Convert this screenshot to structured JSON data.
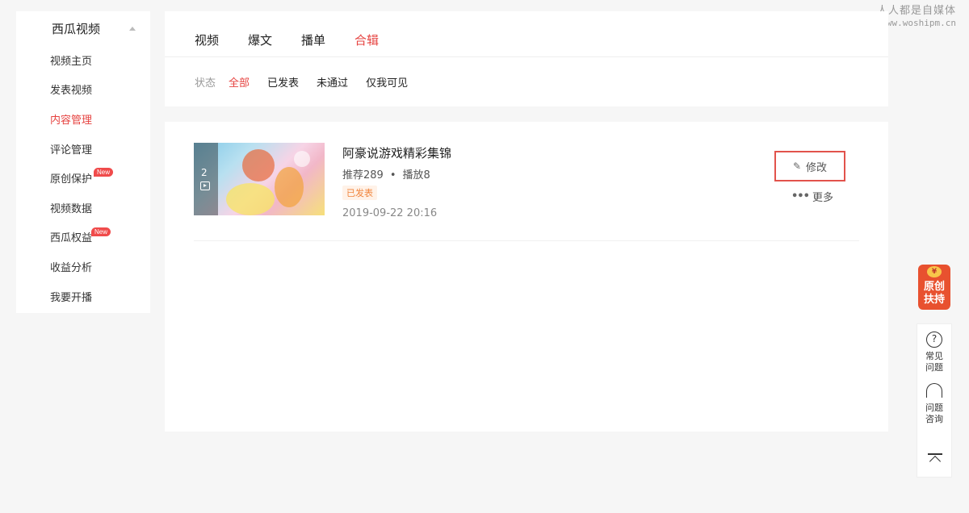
{
  "watermark": {
    "cn": "人人都是自媒体",
    "en": "www.woshipm.cn"
  },
  "sidebar": {
    "title": "西瓜视频",
    "items": [
      {
        "label": "视频主页",
        "active": false,
        "badge": ""
      },
      {
        "label": "发表视频",
        "active": false,
        "badge": ""
      },
      {
        "label": "内容管理",
        "active": true,
        "badge": ""
      },
      {
        "label": "评论管理",
        "active": false,
        "badge": ""
      },
      {
        "label": "原创保护",
        "active": false,
        "badge": "New"
      },
      {
        "label": "视频数据",
        "active": false,
        "badge": ""
      },
      {
        "label": "西瓜权益",
        "active": false,
        "badge": "New"
      },
      {
        "label": "收益分析",
        "active": false,
        "badge": ""
      },
      {
        "label": "我要开播",
        "active": false,
        "badge": ""
      }
    ]
  },
  "tabs": [
    {
      "label": "视频",
      "active": false
    },
    {
      "label": "爆文",
      "active": false
    },
    {
      "label": "播单",
      "active": false
    },
    {
      "label": "合辑",
      "active": true
    }
  ],
  "filters": {
    "label": "状态",
    "options": [
      {
        "label": "全部",
        "active": true
      },
      {
        "label": "已发表",
        "active": false
      },
      {
        "label": "未通过",
        "active": false
      },
      {
        "label": "仅我可见",
        "active": false
      }
    ]
  },
  "content": {
    "item": {
      "count": "2",
      "title": "阿豪说游戏精彩集锦",
      "recommend": "推荐289",
      "dot": "•",
      "plays": "播放8",
      "status": "已发表",
      "time": "2019-09-22 20:16",
      "edit_label": "修改",
      "more_label": "更多"
    }
  },
  "right_widgets": {
    "promo_line1": "原创",
    "promo_line2": "扶持",
    "promo_coin": "¥",
    "faq_line1": "常见",
    "faq_line2": "问题",
    "consult_line1": "问题",
    "consult_line2": "咨询"
  },
  "colors": {
    "accent": "#e64340",
    "tag": "#f0843c",
    "edit_border": "#e2534c",
    "promo": "#e8512f"
  }
}
